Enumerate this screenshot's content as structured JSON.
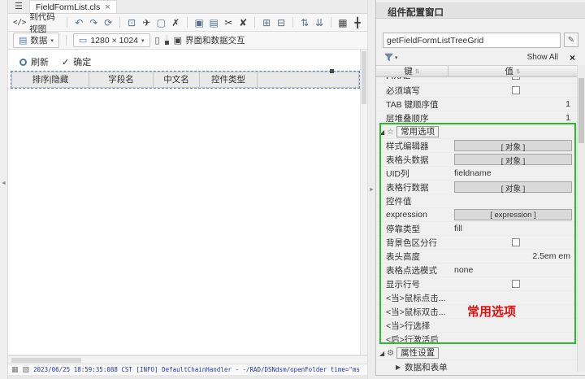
{
  "colors": {
    "accent_green": "#2eb82e",
    "annotation_red": "#e01010",
    "selection_blue": "#5b7fd0",
    "log_blue": "#2233bb"
  },
  "rail": {
    "collapse_left": "◄",
    "collapse_right": "►"
  },
  "tabbar": {
    "menu_icon": "☰",
    "tab_title": "FieldFormList.cls",
    "close_icon": "×"
  },
  "toolbar_top": {
    "code_view_icon": "</>",
    "code_view_label": "到代码视图",
    "icons": {
      "undo": "↶",
      "redo": "↷",
      "refresh": "⟳",
      "export": "⊡",
      "deploy": "✈",
      "preview": "▢",
      "delete": "✗",
      "copy": "▣",
      "paste": "▤",
      "cut": "✂",
      "remove": "✘",
      "copy_format": "⊞",
      "paste_format": "⊟",
      "sort_asc": "⇅",
      "sort_desc": "⇊",
      "grid": "▦",
      "align": "╋"
    }
  },
  "toolbar_view": {
    "data_icon": "▤",
    "data_label": "数据",
    "caret": "▾",
    "screen_icon": "▭",
    "resolution": "1280 × 1024",
    "phone_icon": "▯",
    "interact_icon": "▣",
    "interact_label": "界面和数据交互"
  },
  "canvas": {
    "refresh_label": "刷新",
    "confirm_icon": "✓",
    "confirm_label": "确定",
    "table_headers": [
      "排序|隐藏",
      "字段名",
      "中文名",
      "控件类型"
    ]
  },
  "panel": {
    "title": "组件配置窗口",
    "component_id": "getFieldFormListTreeGrid",
    "edit_icon": "✎",
    "filter_caret": "▾",
    "show_all_label": "Show All",
    "clear_icon": "×",
    "columns": {
      "key": "键",
      "value": "值"
    },
    "sort_icon": "⇅",
    "annotation": "常用选项",
    "rows": [
      {
        "type": "clipped",
        "key": "FIXAE",
        "value": ""
      },
      {
        "type": "check",
        "key": "必须填写",
        "value": ""
      },
      {
        "type": "rtext",
        "key": "TAB 键顺序值",
        "value": "1"
      },
      {
        "type": "rtext",
        "key": "层堆叠顺序",
        "value": "1"
      },
      {
        "type": "section",
        "tri": "◢",
        "icon": "☆",
        "label": "常用选项"
      },
      {
        "type": "obj",
        "key": "样式编辑器",
        "value": "[ 对象 ]"
      },
      {
        "type": "obj",
        "key": "表格头数据",
        "value": "[ 对象 ]"
      },
      {
        "type": "text",
        "key": "UID列",
        "value": "fieldname"
      },
      {
        "type": "obj",
        "key": "表格行数据",
        "value": "[ 对象 ]"
      },
      {
        "type": "text",
        "key": "控件值",
        "value": ""
      },
      {
        "type": "obj",
        "key": "expression",
        "value": "[ expression ]"
      },
      {
        "type": "text",
        "key": "停靠类型",
        "value": "fill"
      },
      {
        "type": "check",
        "key": "背景色区分行",
        "value": ""
      },
      {
        "type": "rtext",
        "key": "表头高度",
        "value": "2.5em em"
      },
      {
        "type": "text",
        "key": "表格点选模式",
        "value": "none"
      },
      {
        "type": "check",
        "key": "显示行号",
        "value": ""
      },
      {
        "type": "text",
        "key": "<当>鼠标点击...",
        "value": ""
      },
      {
        "type": "text",
        "key": "<当>鼠标双击...",
        "value": ""
      },
      {
        "type": "text",
        "key": "<当>行选择",
        "value": ""
      },
      {
        "type": "text",
        "key": "<后>行激活后",
        "value": ""
      },
      {
        "type": "section",
        "tri": "◢",
        "icon": "⚙",
        "label": "属性设置"
      },
      {
        "type": "subsection",
        "tri": "▶",
        "label": "数据和表单"
      }
    ]
  },
  "statusbar": {
    "grid_icon": "▦",
    "panel_icon": "▧",
    "log": "2023/06/25 18:59:35:088 CST [INFO] DefaultChainHandler - -/RAD/DSNdsm/openFolder time=\"ms"
  }
}
